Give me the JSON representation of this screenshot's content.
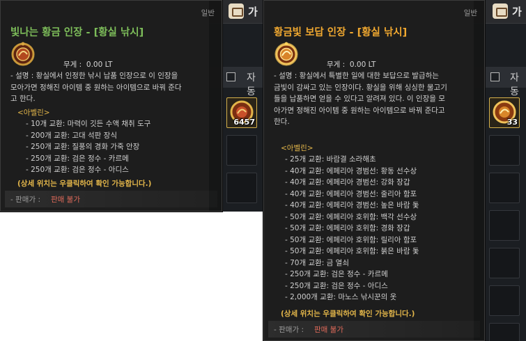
{
  "background_panels": [
    {
      "tab_label": "가",
      "auto_label": "자동",
      "slot_qty": "6457"
    },
    {
      "tab_label": "가",
      "auto_label": "자동",
      "slot_qty": "33"
    }
  ],
  "tooltips": [
    {
      "category": "일반",
      "title": "빛나는 황금 인장 - [황실 낚시]",
      "title_color": "#7dbd5a",
      "icon": "golden-seal-medal-icon",
      "weight_label": "무게 :",
      "weight_value": "0.00 LT",
      "desc_lines": [
        "- 설명 : 황실에서 인정한 낚시 납품 인장으로 이 인장을",
        "모아가면 정해진 아이템 중 원하는 아이템으로 바꿔 준다",
        "고 한다."
      ],
      "section_title": "<아벨린>",
      "exchange_lines": [
        "- 10개 교환: 마력이 깃든 수액 채취 도구",
        "- 200개 교환: 고대 석판 장식",
        "- 250개 교환: 질풍의 경화 가죽 안장",
        "- 250개 교환: 검은 정수 - 카르메",
        "- 250개 교환: 검은 정수 - 아디스"
      ],
      "note": "(상세 위치는 우클릭하여 확인 가능합니다.)",
      "sale_label": "- 판매가 :",
      "sale_value": "판매 불가"
    },
    {
      "category": "일반",
      "title": "황금빛 보답 인장 - [황실 낚시]",
      "title_color": "#f0a830",
      "icon": "golden-reward-seal-medal-icon",
      "weight_label": "무게 :",
      "weight_value": "0.00 LT",
      "desc_lines": [
        "- 설명 : 황실에서 특별한 일에 대한 보답으로 발급하는",
        "금빛이 감싸고 있는 인장이다. 황실을 위해 싱싱한 물고기",
        "들을 납품하면 얻을 수 있다고 알려져 있다. 이 인장을 모",
        "아가면 정해진 아이템 중 원하는 아이템으로 바꿔 준다고",
        "한다."
      ],
      "section_title": "<아벨린>",
      "exchange_lines": [
        "- 25개 교환: 바람결 소라해초",
        "- 40개 교환: 에페리아 경범선: 황동 선수상",
        "- 40개 교환: 에페리아 경범선: 강화 장갑",
        "- 40개 교환: 에페리아 경범선: 줄리아 함포",
        "- 40개 교환: 에페리아 경범선: 높은 바람 돛",
        "- 50개 교환: 에페리아 호위함: 백각 선수상",
        "- 50개 교환: 에페리아 호위함: 경화 장갑",
        "- 50개 교환: 에페리아 호위함: 릴리아 함포",
        "- 50개 교환: 에페리아 호위함: 붉은 바람 돛",
        "- 70개 교환: 금 열쇠",
        "- 250개 교환: 검은 정수 - 카르메",
        "- 250개 교환: 검은 정수 - 아디스",
        "- 2,000개 교환: 마노스 낚시꾼의 옷"
      ],
      "note": "(상세 위치는 우클릭하여 확인 가능합니다.)",
      "sale_label": "- 판매가 :",
      "sale_value": "판매 불가"
    }
  ]
}
